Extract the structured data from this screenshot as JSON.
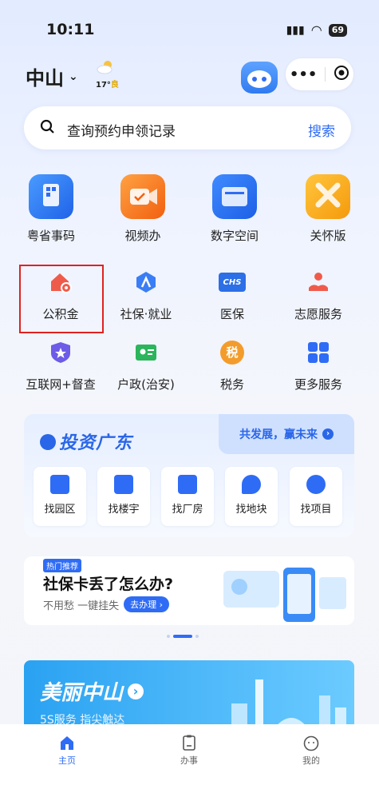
{
  "status_bar": {
    "time": "10:11",
    "battery": "69"
  },
  "header": {
    "city": "中山",
    "weather_temp": "17°",
    "weather_quality": "良"
  },
  "search": {
    "placeholder": "查询预约申领记录",
    "button": "搜索"
  },
  "main_services": [
    {
      "label": "粤省事码",
      "icon": "qr-code-icon"
    },
    {
      "label": "视频办",
      "icon": "video-icon"
    },
    {
      "label": "数字空间",
      "icon": "folder-icon"
    },
    {
      "label": "关怀版",
      "icon": "ribbon-icon"
    }
  ],
  "services_row2": [
    {
      "label": "公积金",
      "icon": "house-fund-icon"
    },
    {
      "label": "社保·就业",
      "icon": "social-security-icon"
    },
    {
      "label": "医保",
      "icon": "medical-insurance-icon",
      "icon_text": "CHS"
    },
    {
      "label": "志愿服务",
      "icon": "volunteer-icon"
    }
  ],
  "services_row3": [
    {
      "label": "互联网+督查",
      "icon": "shield-star-icon"
    },
    {
      "label": "户政(治安)",
      "icon": "id-card-icon"
    },
    {
      "label": "税务",
      "icon": "tax-icon",
      "icon_text": "税"
    },
    {
      "label": "更多服务",
      "icon": "grid-more-icon"
    }
  ],
  "invest": {
    "title": "投资广东",
    "slogan": "共发展，赢未来",
    "items": [
      "找园区",
      "找楼宇",
      "找厂房",
      "找地块",
      "找项目"
    ]
  },
  "banner": {
    "tag": "热门推荐",
    "title": "社保卡丢了怎么办?",
    "subtitle": "不用愁 一键挂失",
    "button": "去办理"
  },
  "feature_card": {
    "title": "美丽中山",
    "subtitle": "5S服务 指尖触达"
  },
  "tabbar": {
    "items": [
      "主页",
      "办事",
      "我的"
    ]
  },
  "colors": {
    "primary": "#2f6cf5",
    "highlight": "#e02222"
  }
}
